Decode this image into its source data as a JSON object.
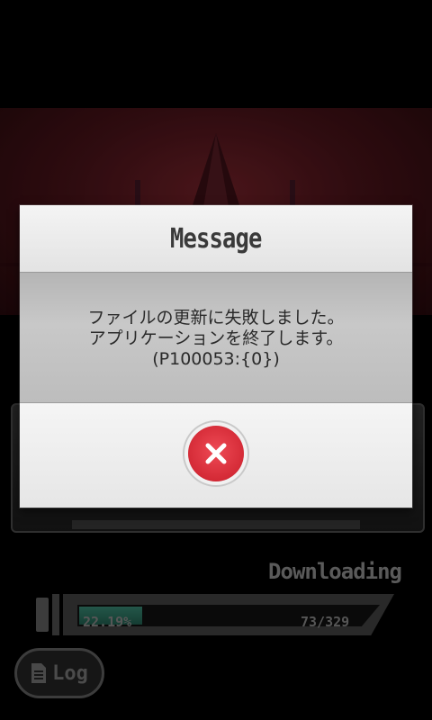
{
  "dialog": {
    "title": "Message",
    "message_lines": [
      "ファイルの更新に失敗しました。",
      "アプリケーションを終了します。",
      "(P100053:{0})"
    ],
    "close_icon": "close-icon"
  },
  "download": {
    "label": "Downloading",
    "percent_text": "22.19%",
    "progress_fraction": 0.2219,
    "count_text": "73/329"
  },
  "log_button": {
    "label": "Log",
    "icon": "document-icon"
  },
  "colors": {
    "close_button": "#d42a36",
    "progress_fill": "#2c6a5a",
    "background_art": "#3a0f14"
  }
}
